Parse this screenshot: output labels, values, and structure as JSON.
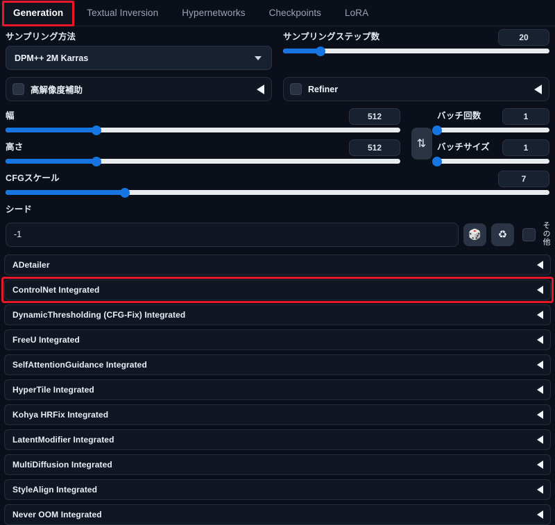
{
  "colors": {
    "accent_blue": "#1675e0",
    "highlight_red": "#e8172a",
    "panel_bg": "#0b0f19",
    "field_bg": "#111722",
    "track": "#e9ecef"
  },
  "tabs": [
    {
      "label": "Generation",
      "active": true,
      "highlighted": true
    },
    {
      "label": "Textual Inversion",
      "active": false,
      "highlighted": false
    },
    {
      "label": "Hypernetworks",
      "active": false,
      "highlighted": false
    },
    {
      "label": "Checkpoints",
      "active": false,
      "highlighted": false
    },
    {
      "label": "LoRA",
      "active": false,
      "highlighted": false
    }
  ],
  "sampler": {
    "label": "サンプリング方法",
    "value": "DPM++ 2M Karras",
    "caret_icon": "chevron-down-icon"
  },
  "steps": {
    "label": "サンプリングステップ数",
    "value": "20",
    "percent": 14
  },
  "hires": {
    "label": "高解像度補助",
    "checked": false,
    "caret_icon": "caret-left-icon"
  },
  "refiner": {
    "label": "Refiner",
    "checked": false,
    "caret_icon": "caret-left-icon"
  },
  "width": {
    "label": "幅",
    "value": "512",
    "percent": 23
  },
  "height": {
    "label": "高さ",
    "value": "512",
    "percent": 23
  },
  "swap": {
    "icon": "swap-vertical-icon",
    "glyph": "⇅"
  },
  "batch_count": {
    "label": "バッチ回数",
    "value": "1",
    "percent": 0
  },
  "batch_size": {
    "label": "バッチサイズ",
    "value": "1",
    "percent": 0
  },
  "cfg": {
    "label": "CFGスケール",
    "value": "7",
    "percent": 22
  },
  "seed": {
    "label": "シード",
    "value": "-1",
    "dice_icon": "dice-icon",
    "dice_glyph": "🎲",
    "recycle_icon": "recycle-icon",
    "recycle_glyph": "♻",
    "extra_checked": false,
    "extra_label": "その他"
  },
  "extensions": [
    {
      "name": "ADetailer",
      "marked": false
    },
    {
      "name": "ControlNet Integrated",
      "marked": true
    },
    {
      "name": "DynamicThresholding (CFG-Fix) Integrated",
      "marked": false
    },
    {
      "name": "FreeU Integrated",
      "marked": false
    },
    {
      "name": "SelfAttentionGuidance Integrated",
      "marked": false
    },
    {
      "name": "HyperTile Integrated",
      "marked": false
    },
    {
      "name": "Kohya HRFix Integrated",
      "marked": false
    },
    {
      "name": "LatentModifier Integrated",
      "marked": false
    },
    {
      "name": "MultiDiffusion Integrated",
      "marked": false
    },
    {
      "name": "StyleAlign Integrated",
      "marked": false
    },
    {
      "name": "Never OOM Integrated",
      "marked": false
    }
  ]
}
